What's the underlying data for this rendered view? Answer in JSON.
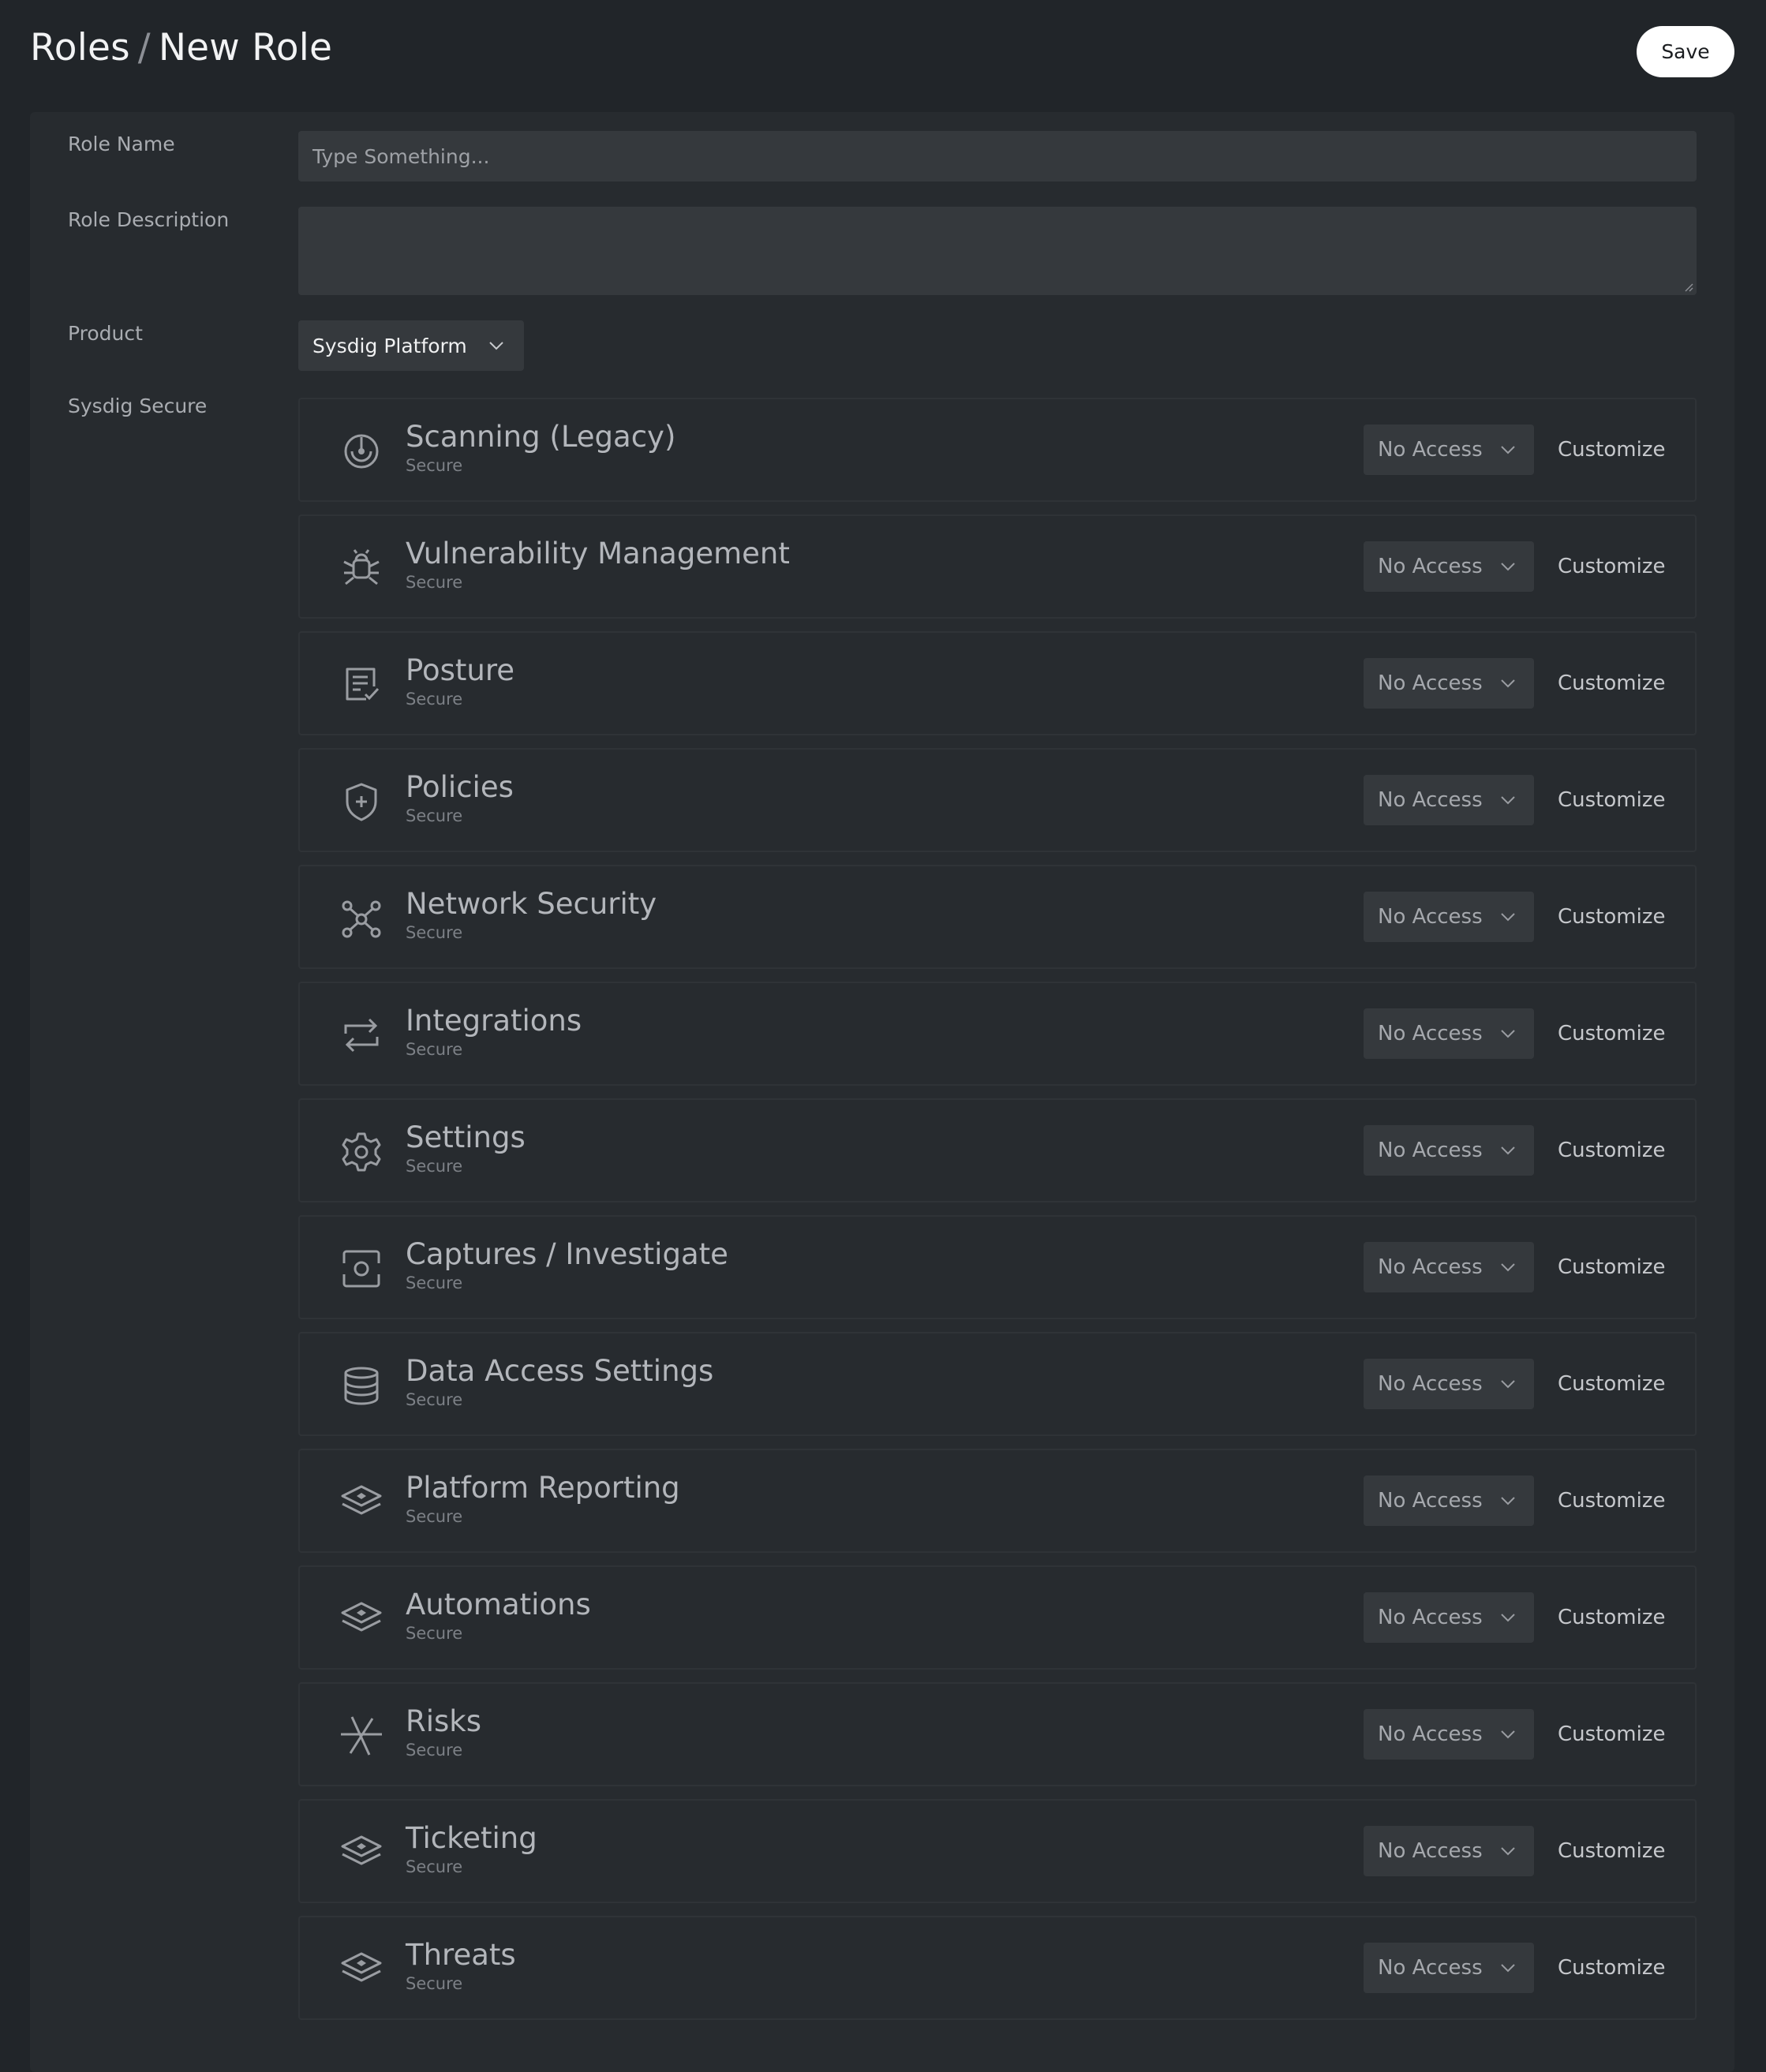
{
  "header": {
    "crumb_parent": "Roles",
    "crumb_separator": "/",
    "crumb_current": "New Role",
    "save_label": "Save"
  },
  "form": {
    "role_name_label": "Role Name",
    "role_name_placeholder": "Type Something...",
    "role_name_value": "",
    "role_description_label": "Role Description",
    "role_description_value": "",
    "product_label": "Product",
    "product_value": "Sysdig Platform",
    "section_label": "Sysdig Secure"
  },
  "permissions": [
    {
      "title": "Scanning (Legacy)",
      "subtitle": "Secure",
      "icon": "scanning-radar-icon",
      "access": "No Access",
      "action": "Customize"
    },
    {
      "title": "Vulnerability Management",
      "subtitle": "Secure",
      "icon": "bug-icon",
      "access": "No Access",
      "action": "Customize"
    },
    {
      "title": "Posture",
      "subtitle": "Secure",
      "icon": "checklist-icon",
      "access": "No Access",
      "action": "Customize"
    },
    {
      "title": "Policies",
      "subtitle": "Secure",
      "icon": "shield-plus-icon",
      "access": "No Access",
      "action": "Customize"
    },
    {
      "title": "Network Security",
      "subtitle": "Secure",
      "icon": "network-nodes-icon",
      "access": "No Access",
      "action": "Customize"
    },
    {
      "title": "Integrations",
      "subtitle": "Secure",
      "icon": "repeat-arrows-icon",
      "access": "No Access",
      "action": "Customize"
    },
    {
      "title": "Settings",
      "subtitle": "Secure",
      "icon": "gear-icon",
      "access": "No Access",
      "action": "Customize"
    },
    {
      "title": "Captures / Investigate",
      "subtitle": "Secure",
      "icon": "capture-focus-icon",
      "access": "No Access",
      "action": "Customize"
    },
    {
      "title": "Data Access Settings",
      "subtitle": "Secure",
      "icon": "database-icon",
      "access": "No Access",
      "action": "Customize"
    },
    {
      "title": "Platform Reporting",
      "subtitle": "Secure",
      "icon": "layers-icon",
      "access": "No Access",
      "action": "Customize"
    },
    {
      "title": "Automations",
      "subtitle": "Secure",
      "icon": "layers-icon",
      "access": "No Access",
      "action": "Customize"
    },
    {
      "title": "Risks",
      "subtitle": "Secure",
      "icon": "risk-burst-icon",
      "access": "No Access",
      "action": "Customize"
    },
    {
      "title": "Ticketing",
      "subtitle": "Secure",
      "icon": "layers-icon",
      "access": "No Access",
      "action": "Customize"
    },
    {
      "title": "Threats",
      "subtitle": "Secure",
      "icon": "layers-icon",
      "access": "No Access",
      "action": "Customize"
    }
  ]
}
